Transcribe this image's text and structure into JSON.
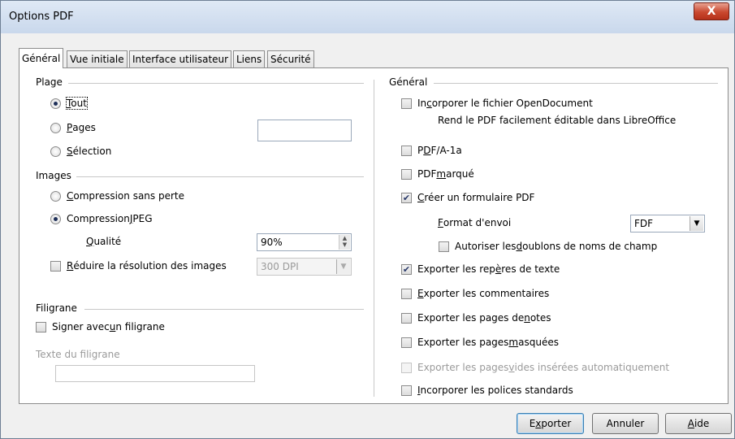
{
  "window": {
    "title": "Options PDF",
    "close_label": "X"
  },
  "tabs": [
    "Général",
    "Vue initiale",
    "Interface utilisateur",
    "Liens",
    "Sécurité"
  ],
  "left": {
    "plage": {
      "title": "Plage",
      "options": [
        {
          "label": "Tout",
          "mnemonic": "T",
          "rest": "out",
          "checked": true
        },
        {
          "label": "Pages",
          "mnemonic": "P",
          "rest": "ages",
          "checked": false
        },
        {
          "label": "Sélection",
          "mnemonic": "S",
          "rest": "élection",
          "checked": false
        }
      ],
      "pages_value": ""
    },
    "images": {
      "title": "Images",
      "lossless": {
        "pre": "",
        "u": "C",
        "post": "ompression sans perte"
      },
      "jpeg": {
        "pre": "Compression ",
        "u": "J",
        "post": "PEG"
      },
      "quality_label": {
        "u": "Q",
        "post": "ualité"
      },
      "quality_value": "90%",
      "reduce": {
        "u": "R",
        "post": "éduire la résolution des images"
      },
      "resolution_value": "300 DPI"
    },
    "filigrane": {
      "title": "Filigrane",
      "sign": {
        "pre": "Signer avec ",
        "u": "u",
        "post": "n filigrane"
      },
      "text_label": "Texte du filigrane",
      "text_value": ""
    }
  },
  "right": {
    "title": "Général",
    "embed": {
      "pre": "In",
      "u": "c",
      "post": "orporer le fichier OpenDocument"
    },
    "embed_hint": "Rend le PDF facilement éditable dans LibreOffice",
    "pdfa": {
      "pre": "P",
      "u": "D",
      "post": "F/A-1a"
    },
    "tagged": {
      "pre": "PDF ",
      "u": "m",
      "post": "arqué"
    },
    "form": {
      "pre": "",
      "u": "C",
      "post": "réer un formulaire PDF"
    },
    "format_label": {
      "u": "F",
      "post": "ormat d'envoi"
    },
    "format_value": "FDF",
    "duplicates": {
      "pre": "Autoriser les ",
      "u": "d",
      "post": "oublons de noms de champ"
    },
    "bookmarks": {
      "pre": "Exporter les rep",
      "u": "è",
      "post": "res de texte"
    },
    "comments": {
      "pre": "",
      "u": "E",
      "post": "xporter les commentaires"
    },
    "notes": {
      "pre": "Exporter les pages de ",
      "u": "n",
      "post": "otes"
    },
    "hidden": {
      "pre": "Exporter les pages ",
      "u": "m",
      "post": "asquées"
    },
    "empty": {
      "pre": "Exporter les pages ",
      "u": "v",
      "post": "ides insérées automatiquement"
    },
    "fonts": {
      "pre": "",
      "u": "I",
      "post": "ncorporer les polices standards"
    }
  },
  "buttons": {
    "export": {
      "pre": "E",
      "u": "x",
      "post": "porter"
    },
    "cancel": "Annuler",
    "help": {
      "u": "A",
      "post": "ide"
    }
  },
  "colors": {
    "accent": "#3c7fb1",
    "close": "#c9482f"
  }
}
